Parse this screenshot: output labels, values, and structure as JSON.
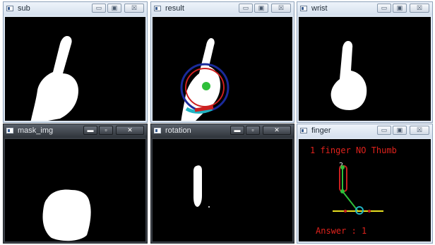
{
  "windows": [
    {
      "id": "sub",
      "title": "sub",
      "buttons": {
        "minimize": "▭",
        "maximize": "▣",
        "close": "☒"
      }
    },
    {
      "id": "result",
      "title": "result",
      "buttons": {
        "minimize": "▭",
        "maximize": "▣",
        "close": "☒"
      }
    },
    {
      "id": "wrist",
      "title": "wrist",
      "buttons": {
        "minimize": "▭",
        "maximize": "▣",
        "close": "☒"
      }
    },
    {
      "id": "mask_img",
      "title": "mask_img",
      "buttons": {
        "minimize": "▬",
        "maximize": "▫",
        "close": "✕"
      }
    },
    {
      "id": "rotation",
      "title": "rotation",
      "buttons": {
        "minimize": "▬",
        "maximize": "▫",
        "close": "✕"
      }
    },
    {
      "id": "finger",
      "title": "finger",
      "buttons": {
        "minimize": "▭",
        "maximize": "▣",
        "close": "☒"
      }
    }
  ],
  "finger_overlay": {
    "status": "1 finger  NO Thumb",
    "answer": "Answer : 1",
    "marker_label": "2"
  },
  "colors": {
    "status_text": "#e0221c",
    "blob": "#ffffff",
    "circle": "#cc2020",
    "hull": "#1a2a9a",
    "center": "#2fbf3a",
    "wrist_band": "#1fb4c4"
  }
}
